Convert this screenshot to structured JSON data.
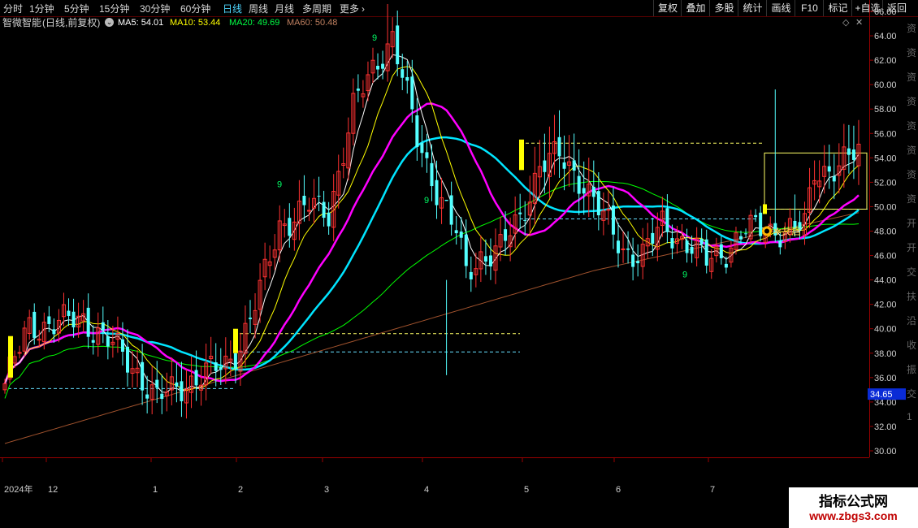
{
  "toolbar": {
    "periods": [
      {
        "label": "分时",
        "active": false
      },
      {
        "label": "1分钟",
        "active": false
      },
      {
        "label": "5分钟",
        "active": false
      },
      {
        "label": "15分钟",
        "active": false
      },
      {
        "label": "30分钟",
        "active": false
      },
      {
        "label": "60分钟",
        "active": false
      },
      {
        "label": "日线",
        "active": true
      },
      {
        "label": "周线",
        "active": false
      },
      {
        "label": "月线",
        "active": false
      },
      {
        "label": "多周期",
        "active": false
      },
      {
        "label": "更多",
        "active": false
      }
    ],
    "buttons": [
      "复权",
      "叠加",
      "多股",
      "统计",
      "画线",
      "F10",
      "标记",
      "+自选",
      "返回"
    ]
  },
  "header": {
    "stock_name": "智微智能",
    "period_mode": "(日线,前复权)",
    "ma5": "MA5: 54.01",
    "ma10": "MA10: 53.44",
    "ma20": "MA20: 49.69",
    "ma60": "MA60: 50.48"
  },
  "colors": {
    "up": "#ff3232",
    "down": "#54ffff",
    "ma5": "#ffffff",
    "ma10": "#ffff00",
    "ma20": "#ff00ff",
    "ma60": "#00ff00",
    "cyan_ma": "#00e5ff",
    "long_ma": "#a0522d",
    "axis": "#990000",
    "price_label": "#ff3333",
    "tag_bg": "#0a2bd6"
  },
  "chart_data": {
    "type": "candlestick",
    "y_ticks": [
      "66.00",
      "64.00",
      "62.00",
      "60.00",
      "58.00",
      "56.00",
      "54.00",
      "52.00",
      "50.00",
      "48.00",
      "46.00",
      "44.00",
      "42.00",
      "40.00",
      "38.00",
      "36.00",
      "34.00",
      "32.00",
      "30.00"
    ],
    "ylim": [
      30,
      67
    ],
    "current_price": "34.65",
    "x_labels": [
      "2024年",
      "12",
      "1",
      "2",
      "3",
      "4",
      "5",
      "6",
      "7"
    ],
    "annotations": [
      "9",
      "9",
      "9",
      "9"
    ],
    "signal_label": "共启"
  },
  "sidebar": {
    "chars": [
      "资",
      "资",
      "资",
      "资",
      "资",
      "资",
      "资",
      "资",
      "开",
      "开",
      "交",
      "扶",
      "沿",
      "收",
      "振",
      "交",
      "1"
    ]
  },
  "watermark": {
    "title": "指标公式网",
    "url": "www.zbgs3.com"
  }
}
